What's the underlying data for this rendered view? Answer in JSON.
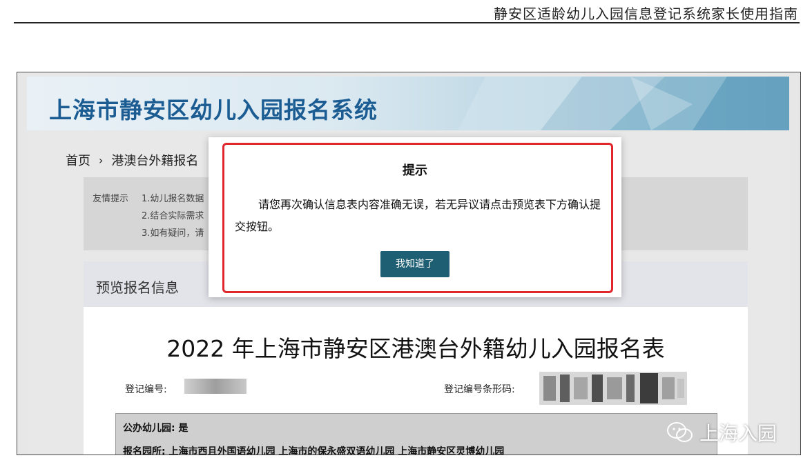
{
  "doc_header": {
    "title": "静安区适龄幼儿入园信息登记系统家长使用指南"
  },
  "banner": {
    "title": "上海市静安区幼儿入园报名系统"
  },
  "breadcrumb": {
    "home": "首页",
    "separator": "›",
    "current": "港澳台外籍报名"
  },
  "tips": {
    "label": "友情提示",
    "lines": [
      "1.幼儿报名数据",
      "2.结合实际需求",
      "3.如有疑问，请"
    ]
  },
  "preview": {
    "header": "预览报名信息",
    "form_title": "2022 年上海市静安区港澳台外籍幼儿入园报名表",
    "reg_no_label": "登记编号:",
    "barcode_label": "登记编号条形码:",
    "rows": [
      "公办幼儿园: 是",
      "报名园所: 上海市西且外国语幼儿园 上海市的保永盛双语幼儿园 上海市静安区灵博幼儿园"
    ]
  },
  "dialog": {
    "title": "提示",
    "message": "请您再次确认信息表内容准确无误，若无异议请点击预览表下方确认提交按钮。",
    "ok_button": "我知道了"
  },
  "watermark": {
    "text": "上海入园"
  },
  "colors": {
    "banner_title": "#1b5c93",
    "button": "#1f5f73",
    "highlight_border": "#e0262b"
  }
}
